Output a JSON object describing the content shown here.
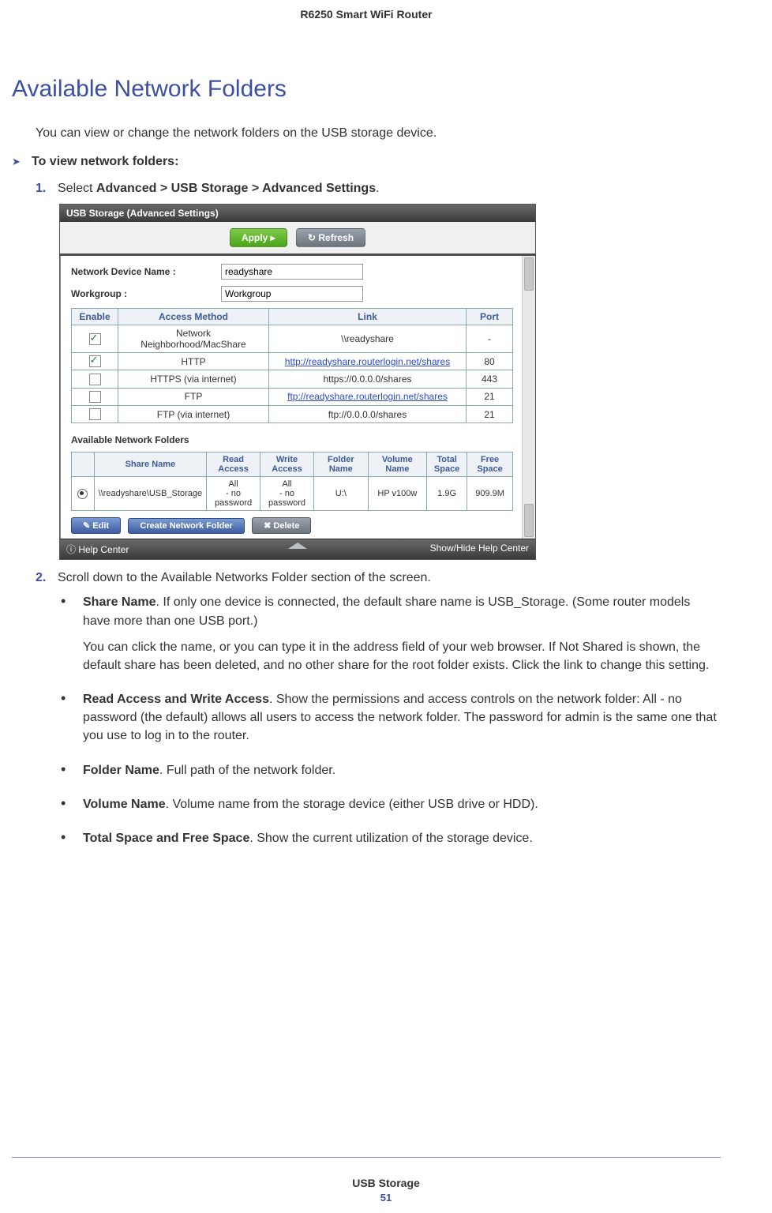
{
  "header": "R6250 Smart WiFi Router",
  "title": "Available Network Folders",
  "intro": "You can view or change the network folders on the USB storage device.",
  "task_heading": "To view network folders:",
  "step1_prefix": "Select ",
  "step1_bold": "Advanced > USB Storage >  Advanced Settings",
  "step1_suffix": ".",
  "step2": "Scroll down to the Available Networks Folder section of the screen.",
  "bullets": [
    {
      "label": "Share Name",
      "text": ". If only one device is connected, the default share name is USB_Storage. (Some router models have more than one USB port.)",
      "extra": "You can click the name, or you can type it in the address field of your web browser. If Not Shared is shown, the default share has been deleted, and no other share for the root folder exists. Click the link to change this setting."
    },
    {
      "label": "Read Access and Write Access",
      "text": ". Show the permissions and access controls on the network folder: All - no password (the default) allows all users to access the network folder. The password for admin is the same one that you use to log in to the router."
    },
    {
      "label": "Folder Name",
      "text": ". Full path of the network folder."
    },
    {
      "label": "Volume Name",
      "text": ". Volume name from the storage device (either USB drive or HDD)."
    },
    {
      "label": "Total Space and Free Space",
      "text": ". Show the current utilization of the storage device."
    }
  ],
  "screenshot": {
    "title": "USB Storage (Advanced Settings)",
    "apply": "Apply ▸",
    "refresh": "↻ Refresh",
    "device_label": "Network Device Name :",
    "device_value": "readyshare",
    "workgroup_label": "Workgroup :",
    "workgroup_value": "Workgroup",
    "cols": {
      "enable": "Enable",
      "method": "Access Method",
      "link": "Link",
      "port": "Port"
    },
    "rows": [
      {
        "checked": true,
        "method": "Network Neighborhood/MacShare",
        "link": "\\\\readyshare",
        "is_link": false,
        "port": "-"
      },
      {
        "checked": true,
        "method": "HTTP",
        "link": "http://readyshare.routerlogin.net/shares",
        "is_link": true,
        "port": "80"
      },
      {
        "checked": false,
        "method": "HTTPS (via internet)",
        "link": "https://0.0.0.0/shares",
        "is_link": false,
        "port": "443"
      },
      {
        "checked": false,
        "method": "FTP",
        "link": "ftp://readyshare.routerlogin.net/shares",
        "is_link": true,
        "port": "21"
      },
      {
        "checked": false,
        "method": "FTP (via internet)",
        "link": "ftp://0.0.0.0/shares",
        "is_link": false,
        "port": "21"
      }
    ],
    "avail_header": "Available Network Folders",
    "fcols": {
      "share": "Share Name",
      "read": "Read Access",
      "write": "Write Access",
      "folder": "Folder Name",
      "volume": "Volume Name",
      "total": "Total Space",
      "free": "Free Space"
    },
    "frow": {
      "share": "\\\\readyshare\\USB_Storage",
      "read": "All\n- no password",
      "write": "All\n- no password",
      "folder": "U:\\",
      "volume": "HP v100w",
      "total": "1.9G",
      "free": "909.9M"
    },
    "edit": "✎ Edit",
    "create": "Create Network Folder",
    "delete": "✖ Delete",
    "help": "ⓘ Help Center",
    "showhide": "Show/Hide Help Center"
  },
  "footer": "USB Storage",
  "page_number": "51"
}
